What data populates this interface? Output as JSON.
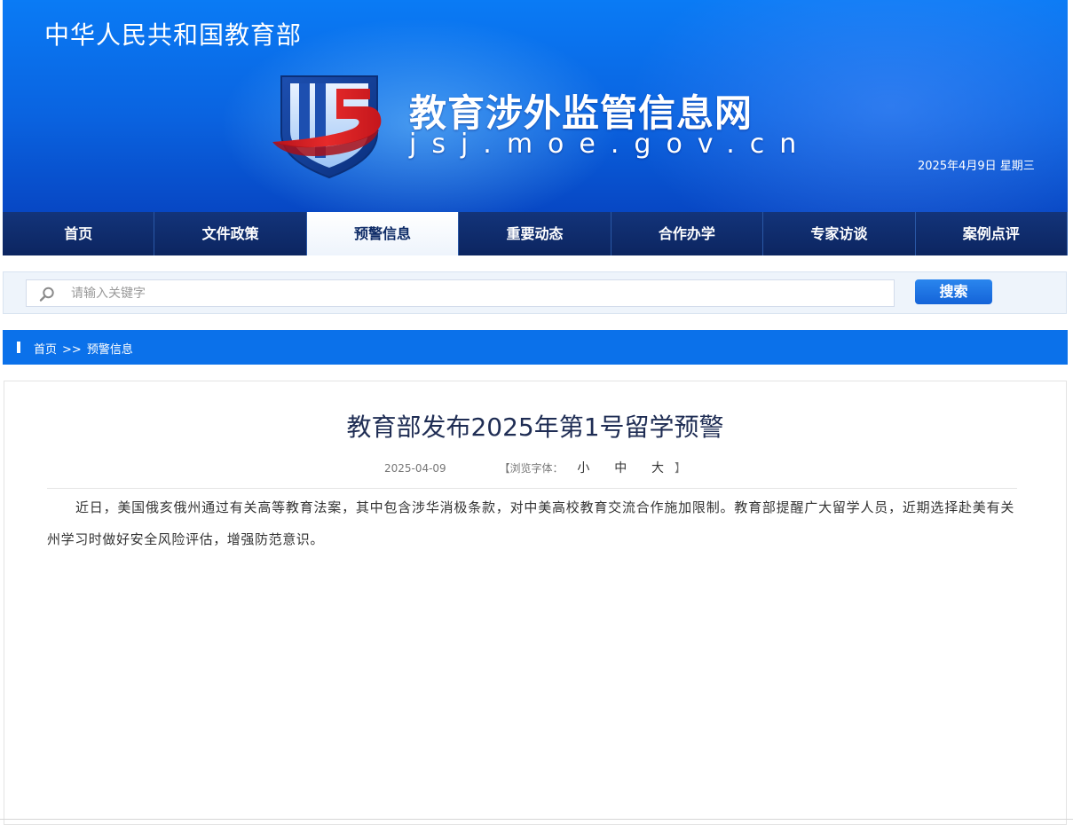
{
  "header": {
    "ministry_name": "中华人民共和国教育部",
    "site_title": "教育涉外监管信息网",
    "site_url": "jsj.moe.gov.cn",
    "date": "2025年4月9日  星期三",
    "logo_icon": "shield-logo-icon"
  },
  "nav": {
    "items": [
      {
        "label": "首页"
      },
      {
        "label": "文件政策"
      },
      {
        "label": "预警信息"
      },
      {
        "label": "重要动态"
      },
      {
        "label": "合作办学"
      },
      {
        "label": "专家访谈"
      },
      {
        "label": "案例点评"
      }
    ],
    "active_index": 2
  },
  "search": {
    "placeholder": "请输入关键字",
    "value": "",
    "button_label": "搜索",
    "icon": "search-icon"
  },
  "breadcrumb": {
    "home": "首页",
    "separator": ">>",
    "current": "预警信息"
  },
  "article": {
    "title": "教育部发布2025年第1号留学预警",
    "publish_date": "2025-04-09",
    "font_size_label": "【浏览字体：",
    "font_size_small": "小",
    "font_size_medium": "中",
    "font_size_large": "大",
    "font_size_close": "】",
    "body": "近日，美国俄亥俄州通过有关高等教育法案，其中包含涉华消极条款，对中美高校教育交流合作施加限制。教育部提醒广大留学人员，近期选择赴美有关州学习时做好安全风险评估，增强防范意识。"
  },
  "colors": {
    "nav_background": "#0f2b68",
    "breadcrumb_background": "#0b71ea",
    "search_button": "#1463d8",
    "title_text": "#1f2d54"
  }
}
